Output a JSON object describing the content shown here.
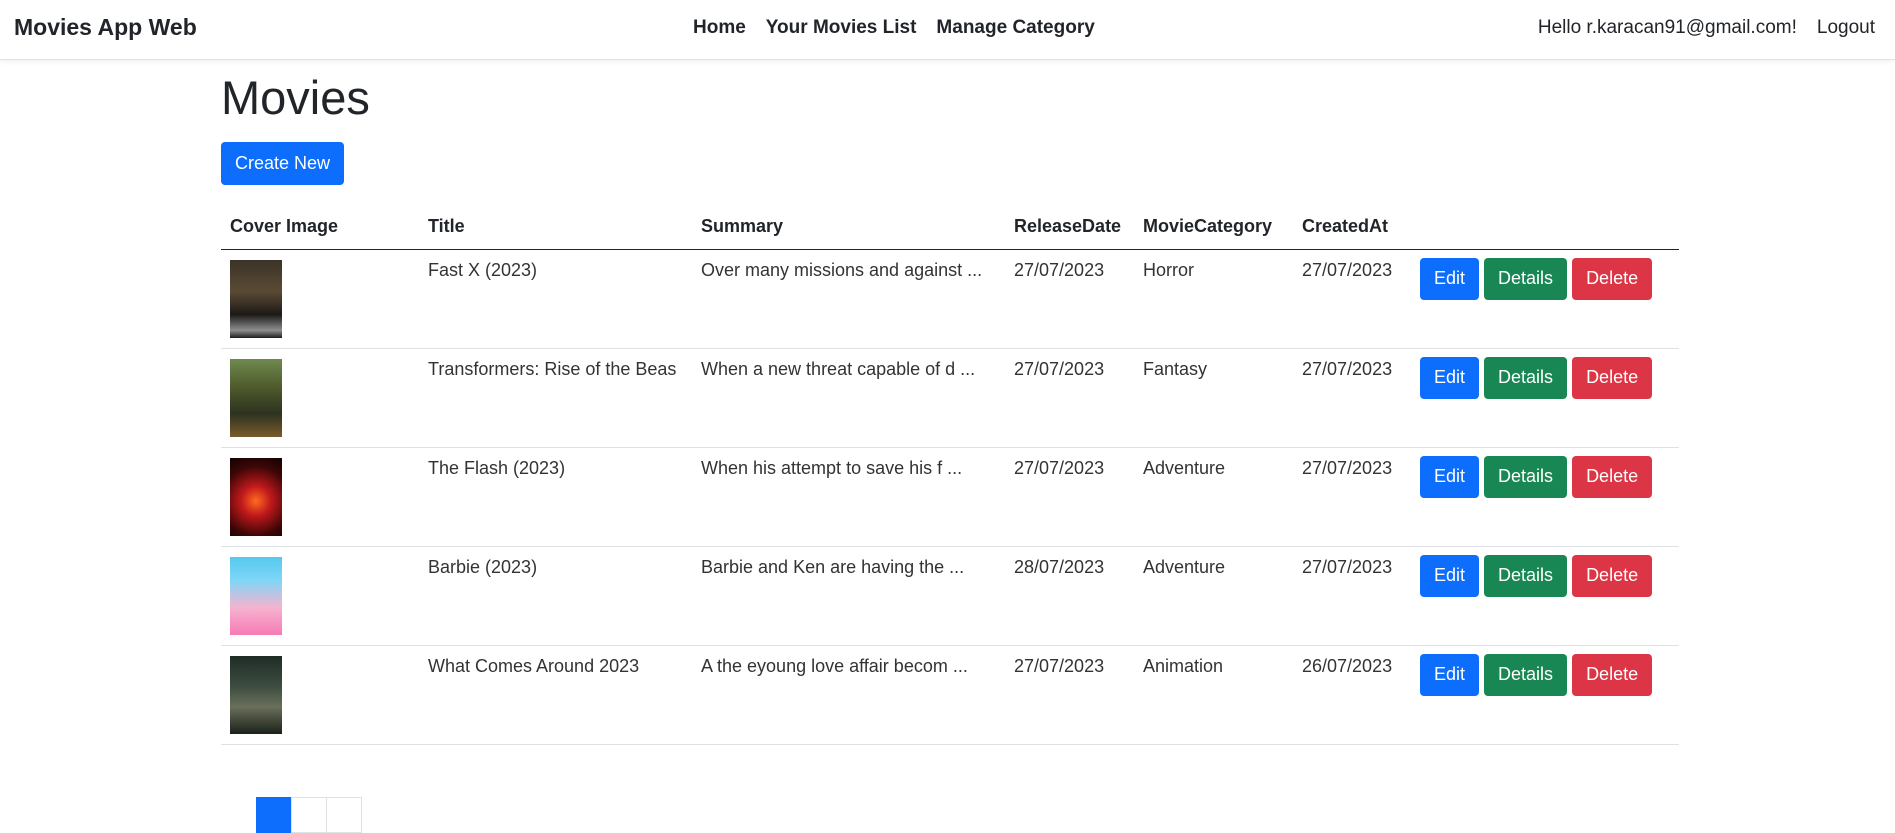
{
  "navbar": {
    "brand": "Movies App Web",
    "links": [
      "Home",
      "Your Movies List",
      "Manage Category"
    ],
    "greeting": "Hello r.karacan91@gmail.com!",
    "logout": "Logout"
  },
  "page": {
    "title": "Movies",
    "create_label": "Create New"
  },
  "table": {
    "headers": [
      "Cover Image",
      "Title",
      "Summary",
      "ReleaseDate",
      "MovieCategory",
      "CreatedAt"
    ],
    "rows": [
      {
        "title": "Fast X (2023)",
        "summary": "Over many missions and against ...",
        "release": "27/07/2023",
        "category": "Horror",
        "created": "27/07/2023",
        "cover": "poster-1"
      },
      {
        "title": "Transformers: Rise of the Beas",
        "summary": "When a new threat capable of d ...",
        "release": "27/07/2023",
        "category": "Fantasy",
        "created": "27/07/2023",
        "cover": "poster-2"
      },
      {
        "title": "The Flash (2023)",
        "summary": "When his attempt to save his f ...",
        "release": "27/07/2023",
        "category": "Adventure",
        "created": "27/07/2023",
        "cover": "poster-3"
      },
      {
        "title": "Barbie (2023)",
        "summary": "Barbie and Ken are having the ...",
        "release": "28/07/2023",
        "category": "Adventure",
        "created": "27/07/2023",
        "cover": "poster-4"
      },
      {
        "title": "What Comes Around 2023",
        "summary": "A the eyoung love affair becom ...",
        "release": "27/07/2023",
        "category": "Animation",
        "created": "26/07/2023",
        "cover": "poster-5"
      }
    ],
    "actions": {
      "edit": "Edit",
      "details": "Details",
      "delete": "Delete"
    }
  },
  "colors": {
    "primary": "#0d6efd",
    "success": "#198754",
    "danger": "#dc3545"
  }
}
